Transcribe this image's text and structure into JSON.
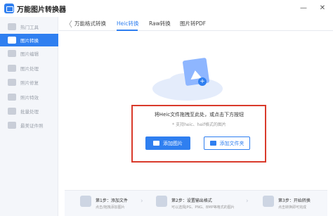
{
  "app": {
    "title": "万能图片转换器"
  },
  "window": {
    "minimize": "—",
    "close": "✕"
  },
  "sidebar": {
    "items": [
      {
        "label": "热门工具"
      },
      {
        "label": "图片转换"
      },
      {
        "label": "图片编辑"
      },
      {
        "label": "图片处理"
      },
      {
        "label": "照片修复"
      },
      {
        "label": "照片特效"
      },
      {
        "label": "批量处理"
      },
      {
        "label": "最美证件照"
      }
    ],
    "active_index": 1
  },
  "tabs": {
    "back": "〈",
    "items": [
      "万能格式转换",
      "Heic转换",
      "Raw转换",
      "图片转PDF"
    ],
    "active_index": 1
  },
  "dropzone": {
    "hint": "将Heic文件拖拽至此处，或点击下方按钮",
    "sub": "* 支持heic、heif格式的图片",
    "add_image": "添加图片",
    "add_folder": "添加文件夹"
  },
  "steps": [
    {
      "title": "第1步：添加文件",
      "sub": "点击/拖拽添加图片"
    },
    {
      "title": "第2步：设置输出格式",
      "sub": "可以选择JPG、PNG、BMP等格式的图片"
    },
    {
      "title": "第3步：开始转换",
      "sub": "点击转换即可完成"
    }
  ],
  "colors": {
    "accent": "#2f7ff0",
    "highlight_border": "#d93a2b"
  },
  "icons": [
    "app-logo-icon",
    "image-icon",
    "folder-icon",
    "cloud-photo-icon"
  ]
}
